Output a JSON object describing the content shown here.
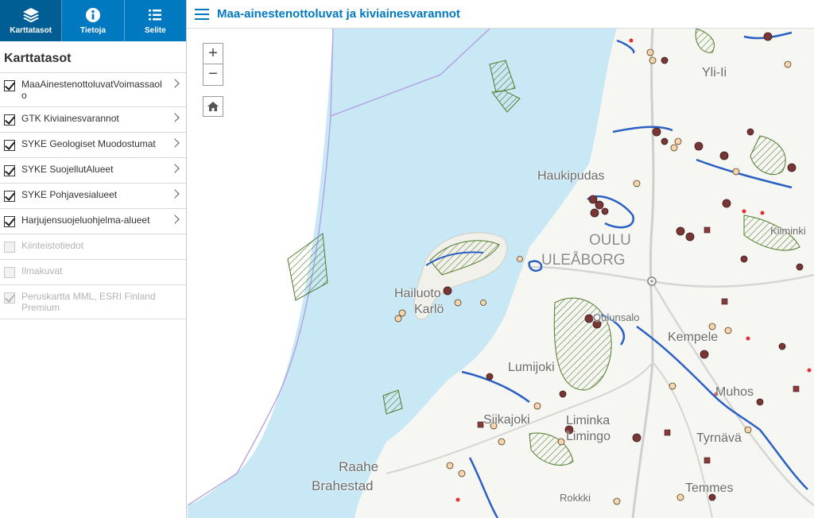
{
  "tabs": [
    {
      "label": "Karttatasot",
      "icon": "layers-icon"
    },
    {
      "label": "Tietoja",
      "icon": "info-icon"
    },
    {
      "label": "Selite",
      "icon": "legend-list-icon"
    }
  ],
  "panel": {
    "title": "Karttatasot"
  },
  "layers": [
    {
      "label": "MaaAinestenottoluvatVoimassaolo",
      "checked": true,
      "enabled": true
    },
    {
      "label": "GTK Kiviainesvarannot",
      "checked": true,
      "enabled": true
    },
    {
      "label": "SYKE Geologiset Muodostumat",
      "checked": true,
      "enabled": true
    },
    {
      "label": "SYKE SuojellutAlueet",
      "checked": true,
      "enabled": true
    },
    {
      "label": "SYKE Pohjavesialueet",
      "checked": true,
      "enabled": true
    },
    {
      "label": "Harjujensuojeluohjelma-alueet",
      "checked": true,
      "enabled": true
    },
    {
      "label": "Kiinteistotiedot",
      "checked": false,
      "enabled": false
    },
    {
      "label": "Ilmakuvat",
      "checked": false,
      "enabled": false
    },
    {
      "label": "Peruskartta MML, ESRI Finland Premium",
      "checked": true,
      "enabled": false
    }
  ],
  "header": {
    "title": "Maa-ainestenottoluvat ja kiviainesvarannot"
  },
  "map_controls": {
    "zoom_in": "+",
    "zoom_out": "−"
  },
  "places": [
    "Yli-Ii",
    "Haukipudas",
    "OULU",
    "ULEÅBORG",
    "Hailuoto",
    "Karlö",
    "Kempele",
    "Lumijoki",
    "Muhos",
    "Siikajoki",
    "Liminka",
    "Limingo",
    "Tyrnävä",
    "Raahe",
    "Brahestad",
    "Temmes",
    "Rokkki",
    "Kiiminki",
    "Oulunsalo"
  ],
  "colors": {
    "accent": "#0079c1",
    "sea": "#c7e8f4",
    "groundwater": "#2a5fc4",
    "hatch": "#4f7a2a",
    "site": "#7a3535"
  }
}
